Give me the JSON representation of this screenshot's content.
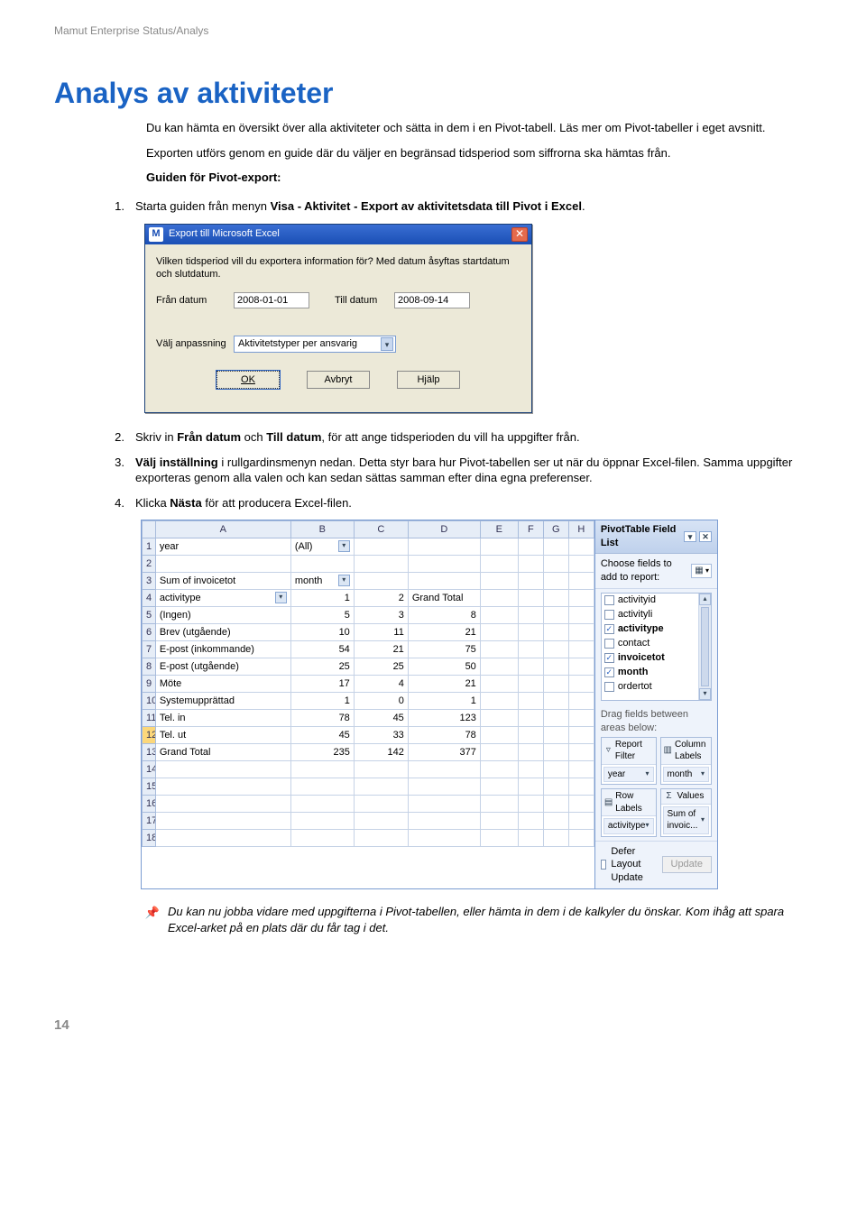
{
  "header": "Mamut Enterprise Status/Analys",
  "title": "Analys av aktiviteter",
  "intro1": "Du kan hämta en översikt över alla aktiviteter och sätta in dem i en Pivot-tabell. Läs mer om Pivot-tabeller i eget avsnitt.",
  "intro2": "Exporten utförs genom en guide där du väljer en begränsad tidsperiod som siffrorna ska hämtas från.",
  "guide_head": "Guiden för Pivot-export:",
  "steps": {
    "s1": {
      "num": "1.",
      "pre": "Starta guiden från menyn ",
      "bold": "Visa - Aktivitet - Export av aktivitetsdata till Pivot i Excel",
      "post": "."
    },
    "s2": {
      "num": "2.",
      "pre": "Skriv in ",
      "b1": "Från datum",
      "mid": " och ",
      "b2": "Till datum",
      "post": ", för att ange tidsperioden du vill ha uppgifter från."
    },
    "s3": {
      "num": "3.",
      "b1": "Välj inställning",
      "post": " i rullgardinsmenyn nedan. Detta styr bara hur Pivot-tabellen ser ut när du öppnar Excel-filen. Samma uppgifter exporteras genom alla valen och kan sedan sättas samman efter dina egna preferenser."
    },
    "s4": {
      "num": "4.",
      "pre": "Klicka ",
      "b1": "Nästa",
      "post": " för att producera Excel-filen."
    }
  },
  "dialog": {
    "title": "Export till Microsoft Excel",
    "desc": "Vilken tidsperiod vill du exportera information för? Med datum åsyftas startdatum och slutdatum.",
    "from_label": "Från datum",
    "from_value": "2008-01-01",
    "to_label": "Till datum",
    "to_value": "2008-09-14",
    "select_label": "Välj anpassning",
    "select_value": "Aktivitetstyper per ansvarig",
    "ok": "OK",
    "cancel": "Avbryt",
    "help": "Hjälp"
  },
  "excel": {
    "cols": [
      "A",
      "B",
      "C",
      "D",
      "E",
      "F",
      "G",
      "H"
    ],
    "row_labels": [
      "1",
      "2",
      "3",
      "4",
      "5",
      "6",
      "7",
      "8",
      "9",
      "10",
      "11",
      "12",
      "13",
      "14",
      "15",
      "16",
      "17",
      "18"
    ],
    "year": "year",
    "all": "(All)",
    "sum": "Sum of invoicetot",
    "month": "month",
    "acttype": "activitype",
    "grand_total_col": "Grand Total",
    "c1": "1",
    "c2": "2",
    "rows": [
      {
        "name": "(Ingen)",
        "v1": "5",
        "v2": "3",
        "gt": "8"
      },
      {
        "name": "Brev (utgående)",
        "v1": "10",
        "v2": "11",
        "gt": "21"
      },
      {
        "name": "E-post (inkommande)",
        "v1": "54",
        "v2": "21",
        "gt": "75"
      },
      {
        "name": "E-post (utgående)",
        "v1": "25",
        "v2": "25",
        "gt": "50"
      },
      {
        "name": "Möte",
        "v1": "17",
        "v2": "4",
        "gt": "21"
      },
      {
        "name": "Systemupprättad",
        "v1": "1",
        "v2": "0",
        "gt": "1"
      },
      {
        "name": "Tel. in",
        "v1": "78",
        "v2": "45",
        "gt": "123"
      },
      {
        "name": "Tel. ut",
        "v1": "45",
        "v2": "33",
        "gt": "78"
      }
    ],
    "grand_total_row": {
      "name": "Grand Total",
      "v1": "235",
      "v2": "142",
      "gt": "377"
    }
  },
  "pivot": {
    "title": "PivotTable Field List",
    "choose": "Choose fields to add to report:",
    "fields": [
      {
        "name": "activityid",
        "checked": false,
        "bold": false
      },
      {
        "name": "activityli",
        "checked": false,
        "bold": false
      },
      {
        "name": "activitype",
        "checked": true,
        "bold": true
      },
      {
        "name": "contact",
        "checked": false,
        "bold": false
      },
      {
        "name": "invoicetot",
        "checked": true,
        "bold": true
      },
      {
        "name": "month",
        "checked": true,
        "bold": true
      },
      {
        "name": "ordertot",
        "checked": false,
        "bold": false
      }
    ],
    "drag": "Drag fields between areas below:",
    "area_filter": "Report Filter",
    "area_cols": "Column Labels",
    "area_rows": "Row Labels",
    "area_vals": "Values",
    "item_year": "year",
    "item_month": "month",
    "item_act": "activitype",
    "item_sum": "Sum of invoic...",
    "defer": "Defer Layout Update",
    "update": "Update",
    "sigma": "Σ"
  },
  "note": " Du kan nu jobba vidare med uppgifterna i Pivot-tabellen, eller hämta in dem i de kalkyler du önskar. Kom ihåg att spara Excel-arket på en plats där du får tag i det.",
  "page_num": "14",
  "chart_data": {
    "type": "table",
    "title": "Sum of invoicetot by activitype × month",
    "columns": [
      "activitype",
      "1",
      "2",
      "Grand Total"
    ],
    "rows": [
      [
        "(Ingen)",
        5,
        3,
        8
      ],
      [
        "Brev (utgående)",
        10,
        11,
        21
      ],
      [
        "E-post (inkommande)",
        54,
        21,
        75
      ],
      [
        "E-post (utgående)",
        25,
        25,
        50
      ],
      [
        "Möte",
        17,
        4,
        21
      ],
      [
        "Systemupprättad",
        1,
        0,
        1
      ],
      [
        "Tel. in",
        78,
        45,
        123
      ],
      [
        "Tel. ut",
        45,
        33,
        78
      ],
      [
        "Grand Total",
        235,
        142,
        377
      ]
    ]
  }
}
